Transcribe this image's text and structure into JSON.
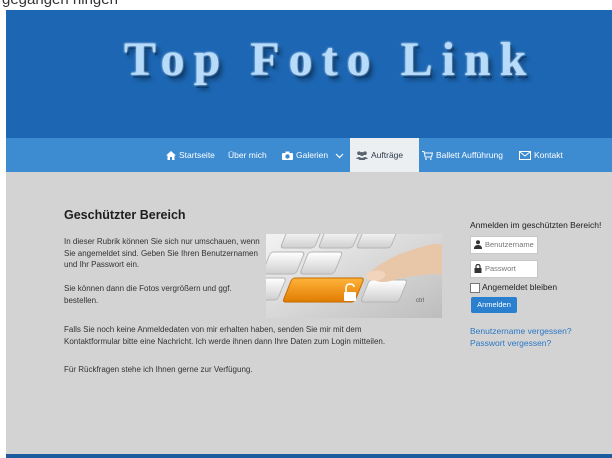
{
  "top_fragment": "gegangen hingen",
  "header": {
    "logo": "Top Foto Link"
  },
  "nav": {
    "items": [
      {
        "label": "Startseite",
        "icon": "home-icon"
      },
      {
        "label": "Über mich",
        "icon": ""
      },
      {
        "label": "Galerien",
        "icon": "camera-icon"
      },
      {
        "label": "Aufträge",
        "icon": "users-icon",
        "active": true
      },
      {
        "label": "Ballett Aufführung",
        "icon": "cart-icon"
      },
      {
        "label": "Kontakt",
        "icon": "mail-icon"
      }
    ]
  },
  "main": {
    "title": "Geschützter Bereich",
    "para1": "In dieser Rubrik können Sie sich nur umschauen, wenn Sie angemeldet sind. Geben Sie Ihren Benutzernamen und Ihr Passwort ein.",
    "para2": "Sie können dann die Fotos vergrößern und ggf. bestellen.",
    "para3": "Falls Sie noch keine Anmeldedaten von mir erhalten haben, senden Sie mir mit dem Kontaktformular bitte eine Nachricht. Ich werde ihnen dann Ihre Daten zum Login mitteilen.",
    "para4": "Für Rückfragen stehe ich Ihnen gerne zur Verfügung.",
    "hero_key_label": "ctrl"
  },
  "login": {
    "title": "Anmelden im geschützten Bereich!",
    "username_placeholder": "Benutzername",
    "password_placeholder": "Passwort",
    "remember_label": "Angemeldet bleiben",
    "submit_label": "Anmelden",
    "forgot_username": "Benutzername vergessen?",
    "forgot_password": "Passwort vergessen?"
  },
  "colors": {
    "header": "#1c66b3",
    "nav": "#3d8bd1",
    "accent": "#f29a1b",
    "link": "#2b78c5"
  }
}
